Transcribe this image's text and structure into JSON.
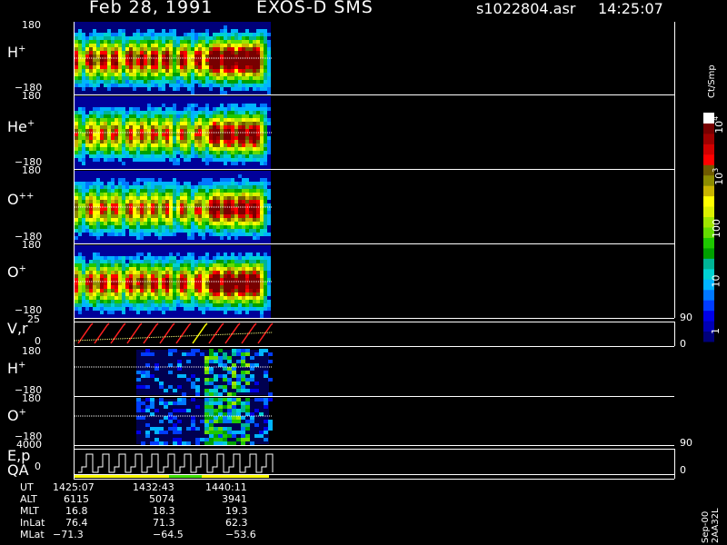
{
  "header": {
    "date": "Feb 28, 1991",
    "instrument": "EXOS-D SMS",
    "file": "s1022804.asr",
    "time": "14:25:07"
  },
  "panels": [
    {
      "id": "h_plus",
      "label": "H",
      "sup": "+",
      "ytop": "180",
      "ybot": "−180"
    },
    {
      "id": "he_plus",
      "label": "He",
      "sup": "+",
      "ytop": "180",
      "ybot": "−180"
    },
    {
      "id": "o_pp",
      "label": "O",
      "sup": "++",
      "ytop": "180",
      "ybot": "−180"
    },
    {
      "id": "o_plus",
      "label": "O",
      "sup": "+",
      "ytop": "180",
      "ybot": "−180"
    },
    {
      "id": "vr",
      "label": "V,r",
      "sup": "",
      "ytop": "25",
      "ybot": "0"
    },
    {
      "id": "h_plus2",
      "label": "H",
      "sup": "+",
      "ytop": "180",
      "ybot": "−180"
    },
    {
      "id": "o_plus2",
      "label": "O",
      "sup": "+",
      "ytop": "180",
      "ybot": "−180"
    },
    {
      "id": "ep",
      "label": "E,p",
      "sup": "",
      "ytop": "4000",
      "ybot": "0"
    }
  ],
  "qa_label": "QA",
  "right_axis": {
    "vr_top": "90",
    "vr_bot": "0",
    "ep_top": "90",
    "ep_bot": "0"
  },
  "colorbar": {
    "title": "Ct/Smp",
    "labels": [
      "1",
      "10",
      "100",
      "10",
      "10"
    ],
    "label_sups": [
      "",
      "",
      "",
      "3",
      "4"
    ],
    "colors": [
      "#00007a",
      "#0000b4",
      "#0000e6",
      "#003cff",
      "#0078ff",
      "#00b4ff",
      "#00d2d2",
      "#00b496",
      "#00a000",
      "#1ec800",
      "#64dc00",
      "#a0e600",
      "#dcf000",
      "#ffff00",
      "#c8b400",
      "#8c8c00",
      "#6e5a00",
      "#ff0000",
      "#d20000",
      "#a00000",
      "#780000",
      "#ffffff"
    ]
  },
  "footer": {
    "rows": [
      {
        "label": "UT",
        "values": [
          "1425:07",
          "1432:43",
          "1440:11"
        ]
      },
      {
        "label": "ALT",
        "values": [
          "6115",
          "5074",
          "3941"
        ]
      },
      {
        "label": "MLT",
        "values": [
          "16.8",
          "18.3",
          "19.3"
        ]
      },
      {
        "label": "InLat",
        "values": [
          "76.4",
          "71.3",
          "62.3"
        ]
      },
      {
        "label": "MLat",
        "values": [
          "−71.3",
          "−64.5",
          "−53.6"
        ]
      }
    ],
    "version": "Sep-00 2AA32L"
  },
  "chart_data": {
    "type": "heatmap",
    "x_ticks": [
      "1425:07",
      "1432:43",
      "1440:11"
    ],
    "panels": [
      {
        "label": "H+",
        "ylim": [
          -180,
          180
        ]
      },
      {
        "label": "He+",
        "ylim": [
          -180,
          180
        ]
      },
      {
        "label": "O++",
        "ylim": [
          -180,
          180
        ]
      },
      {
        "label": "O+",
        "ylim": [
          -180,
          180
        ]
      },
      {
        "label": "V,r",
        "ylim": [
          0,
          25
        ],
        "right_ylim": [
          0,
          90
        ]
      },
      {
        "label": "H+",
        "ylim": [
          -180,
          180
        ]
      },
      {
        "label": "O+",
        "ylim": [
          -180,
          180
        ]
      },
      {
        "label": "E,p",
        "ylim": [
          0,
          4000
        ],
        "right_ylim": [
          0,
          90
        ]
      }
    ],
    "colorbar_title": "Ct/Smp",
    "colorbar_ticks": [
      "1",
      "10",
      "100",
      "10^3",
      "10^4"
    ]
  }
}
